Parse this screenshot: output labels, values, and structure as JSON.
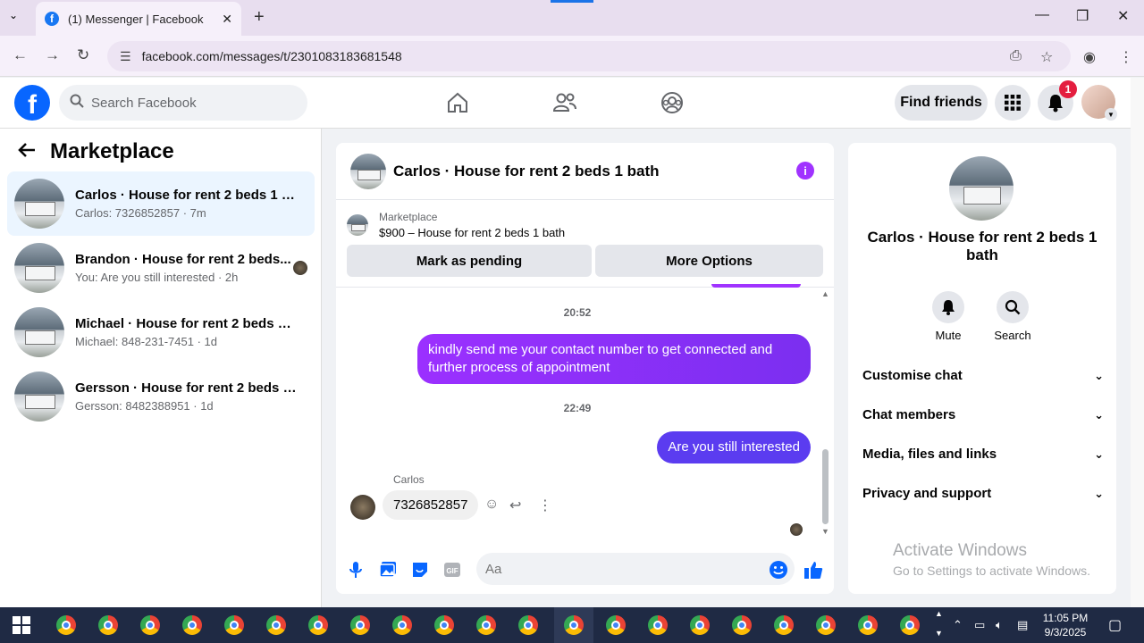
{
  "browser": {
    "tab_title": "(1) Messenger | Facebook",
    "url": "facebook.com/messages/t/2301083183681548"
  },
  "header": {
    "search_placeholder": "Search Facebook",
    "find_friends": "Find friends",
    "notification_count": "1"
  },
  "sidebar": {
    "title": "Marketplace",
    "conversations": [
      {
        "name": "Carlos · House for rent 2 beds 1 bath",
        "sub": "Carlos: 7326852857 · 7m"
      },
      {
        "name": "Brandon · House for rent 2 beds...",
        "sub": "You: Are you still interested · 2h"
      },
      {
        "name": "Michael · House for rent 2 beds 1 ...",
        "sub": "Michael: 848-231-7451 · 1d"
      },
      {
        "name": "Gersson · House for rent 2 beds 1 ...",
        "sub": "Gersson: 8482388951 · 1d"
      }
    ]
  },
  "chat": {
    "title": "Carlos · House for rent 2 beds 1 bath",
    "marketplace_label": "Marketplace",
    "listing": "$900 – House for rent 2 beds 1 bath",
    "mark_pending": "Mark as pending",
    "more_options": "More Options",
    "time1": "20:52",
    "msg1": "kindly send me your contact number to get connected and further process of appointment",
    "time2": "22:49",
    "msg2": "Are you still interested",
    "sender": "Carlos",
    "msg3": "7326852857",
    "composer_placeholder": "Aa"
  },
  "rpanel": {
    "name": "Carlos · House for rent 2 beds 1 bath",
    "mute": "Mute",
    "search": "Search",
    "rows": [
      "Customise chat",
      "Chat members",
      "Media, files and links",
      "Privacy and support"
    ]
  },
  "watermark": {
    "line1": "Activate Windows",
    "line2": "Go to Settings to activate Windows."
  },
  "taskbar": {
    "time": "11:05 PM",
    "date": "9/3/2025"
  },
  "colors": {
    "fb_blue": "#0866ff",
    "bubble_purple": "#8a2be2",
    "active_row": "#ebf5ff"
  }
}
